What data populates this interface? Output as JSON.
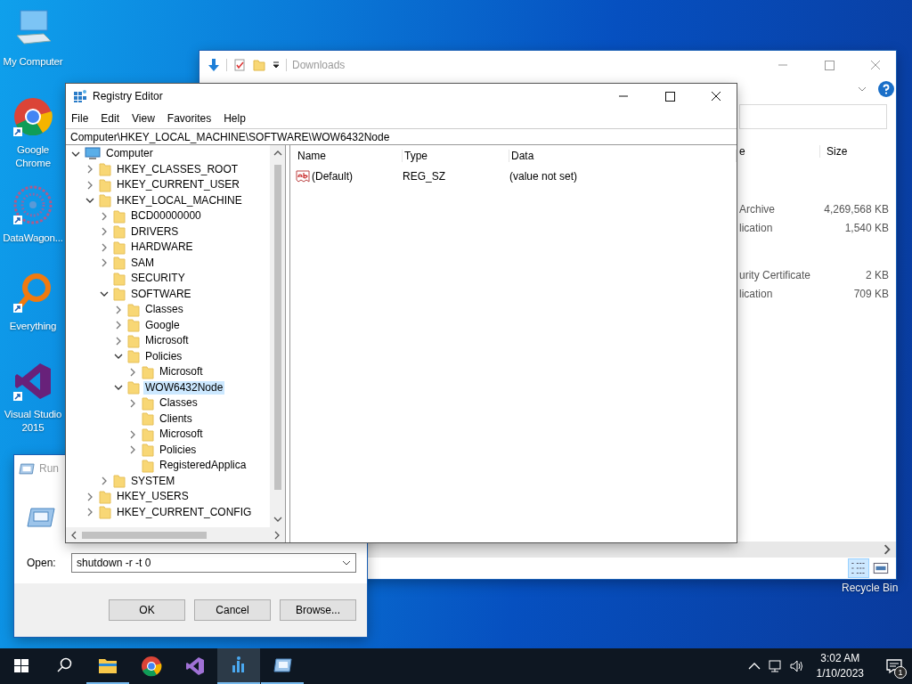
{
  "desktop": {
    "icons": [
      {
        "kind": "computer",
        "label": "My Computer",
        "shortcut": false
      },
      {
        "kind": "chrome",
        "label": "Google Chrome",
        "shortcut": true
      },
      {
        "kind": "datawagon",
        "label": "DataWagon...",
        "shortcut": true
      },
      {
        "kind": "everything",
        "label": "Everything",
        "shortcut": true
      },
      {
        "kind": "vs",
        "label": "Visual Studio 2015",
        "shortcut": true
      }
    ],
    "recycle_bin": {
      "label": "Recycle Bin"
    }
  },
  "explorer": {
    "title": "Downloads",
    "columns": [
      {
        "label": "e"
      },
      {
        "label": "Size"
      }
    ],
    "groups": [
      {
        "rows": [
          {
            "column_1": "Archive",
            "size": "4,269,568 KB"
          },
          {
            "column_1": "lication",
            "size": "1,540 KB"
          }
        ]
      },
      {
        "rows": [
          {
            "column_1": "urity Certificate",
            "size": "2 KB"
          },
          {
            "column_1": "lication",
            "size": "709 KB"
          }
        ]
      }
    ],
    "views": [
      {
        "kind": "details",
        "selected": true
      },
      {
        "kind": "tiles",
        "selected": false
      }
    ]
  },
  "registry_editor": {
    "title": "Registry Editor",
    "menu": [
      "File",
      "Edit",
      "View",
      "Favorites",
      "Help"
    ],
    "address": "Computer\\HKEY_LOCAL_MACHINE\\SOFTWARE\\WOW6432Node",
    "tree": [
      {
        "label": "Computer",
        "kind": "computer",
        "expanded": true,
        "selected": false,
        "children": [
          {
            "label": "HKEY_CLASSES_ROOT",
            "expanded": false,
            "selected": false
          },
          {
            "label": "HKEY_CURRENT_USER",
            "expanded": false,
            "selected": false
          },
          {
            "label": "HKEY_LOCAL_MACHINE",
            "expanded": true,
            "selected": false,
            "children": [
              {
                "label": "BCD00000000",
                "expanded": false,
                "selected": false
              },
              {
                "label": "DRIVERS",
                "expanded": false,
                "selected": false
              },
              {
                "label": "HARDWARE",
                "expanded": false,
                "selected": false
              },
              {
                "label": "SAM",
                "expanded": false,
                "selected": false
              },
              {
                "label": "SECURITY",
                "selected": false
              },
              {
                "label": "SOFTWARE",
                "expanded": true,
                "selected": false,
                "children": [
                  {
                    "label": "Classes",
                    "expanded": false,
                    "selected": false
                  },
                  {
                    "label": "Google",
                    "expanded": false,
                    "selected": false
                  },
                  {
                    "label": "Microsoft",
                    "expanded": false,
                    "selected": false
                  },
                  {
                    "label": "Policies",
                    "expanded": true,
                    "selected": false,
                    "children": [
                      {
                        "label": "Microsoft",
                        "expanded": false,
                        "selected": false
                      }
                    ]
                  },
                  {
                    "label": "WOW6432Node",
                    "expanded": true,
                    "selected": true,
                    "children": [
                      {
                        "label": "Classes",
                        "expanded": false,
                        "selected": false
                      },
                      {
                        "label": "Clients",
                        "selected": false
                      },
                      {
                        "label": "Microsoft",
                        "expanded": false,
                        "selected": false
                      },
                      {
                        "label": "Policies",
                        "expanded": false,
                        "selected": false
                      },
                      {
                        "label": "RegisteredApplica",
                        "selected": false
                      }
                    ]
                  }
                ]
              },
              {
                "label": "SYSTEM",
                "expanded": false,
                "selected": false
              }
            ]
          },
          {
            "label": "HKEY_USERS",
            "expanded": false,
            "selected": false
          },
          {
            "label": "HKEY_CURRENT_CONFIG",
            "expanded": false,
            "selected": false
          }
        ]
      }
    ],
    "columns": [
      "Name",
      "Type",
      "Data"
    ],
    "values": [
      {
        "name": "(Default)",
        "type": "REG_SZ",
        "data": "(value not set)"
      }
    ]
  },
  "run_dialog": {
    "title": "Run",
    "open_label": "Open:",
    "command": "shutdown -r -t 0",
    "buttons": [
      "OK",
      "Cancel",
      "Browse..."
    ]
  },
  "taskbar": {
    "apps": [
      {
        "kind": "explorer",
        "running": true,
        "active": false
      },
      {
        "kind": "chrome",
        "running": false,
        "active": false
      },
      {
        "kind": "vs",
        "running": false,
        "active": false
      },
      {
        "kind": "datawagon",
        "running": true,
        "active": true
      },
      {
        "kind": "run",
        "running": true,
        "active": false
      }
    ],
    "time": "3:02 AM",
    "date": "1/10/2023",
    "notification_count": "1"
  }
}
